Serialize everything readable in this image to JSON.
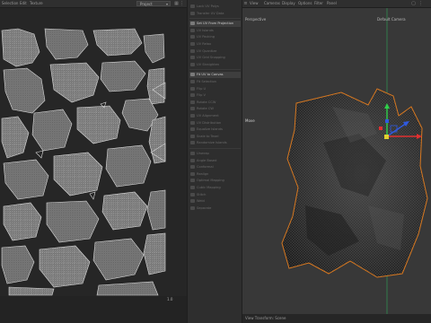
{
  "uv_editor": {
    "menus": [
      "Selection",
      "Edit",
      "Texture"
    ],
    "dropdown_value": "Project",
    "scale_readout": "1.0"
  },
  "tools": {
    "items": [
      {
        "label": "Lock UV Polys",
        "active": false
      },
      {
        "label": "Transfer UV Data",
        "active": false
      },
      {
        "label": "Set UV From Projection",
        "active": true
      },
      {
        "label": "UV Islands",
        "active": false
      },
      {
        "label": "UV Packing",
        "active": false
      },
      {
        "label": "UV Relax",
        "active": false
      },
      {
        "label": "UV Quantize",
        "active": false
      },
      {
        "label": "UV Grid Snapping",
        "active": false
      },
      {
        "label": "UV Straighten",
        "active": false
      },
      {
        "label": "Fit UV to Canvas",
        "active": true
      },
      {
        "label": "Fit Selection",
        "active": false
      },
      {
        "label": "Flip U",
        "active": false
      },
      {
        "label": "Flip V",
        "active": false
      },
      {
        "label": "Rotate CCW",
        "active": false
      },
      {
        "label": "Rotate CW",
        "active": false
      },
      {
        "label": "UV Alignment",
        "active": false
      },
      {
        "label": "UV Distribution",
        "active": false
      },
      {
        "label": "Equalize Islands",
        "active": false
      },
      {
        "label": "Scale to Texel",
        "active": false
      },
      {
        "label": "Randomize Islands",
        "active": false
      },
      {
        "label": "Unwrap",
        "active": false
      },
      {
        "label": "Angle Based",
        "active": false
      },
      {
        "label": "Conformal",
        "active": false
      },
      {
        "label": "Realign",
        "active": false
      },
      {
        "label": "Optimal Mapping",
        "active": false
      },
      {
        "label": "Cubic Mapping",
        "active": false
      },
      {
        "label": "Stitch",
        "active": false
      },
      {
        "label": "Weld",
        "active": false
      },
      {
        "label": "Separate",
        "active": false
      }
    ]
  },
  "viewport": {
    "menus": [
      "View",
      "Cameras",
      "Display",
      "Options",
      "Filter",
      "Panel"
    ],
    "perspective_label": "Perspective",
    "camera_label": "Default Camera",
    "move_label": "Move",
    "status_text": "View Transform: Scene"
  },
  "colors": {
    "selection_outline": "#e07a1c",
    "axis_x": "#e03030",
    "axis_y": "#2fd04a",
    "axis_z": "#2f5ae0"
  }
}
